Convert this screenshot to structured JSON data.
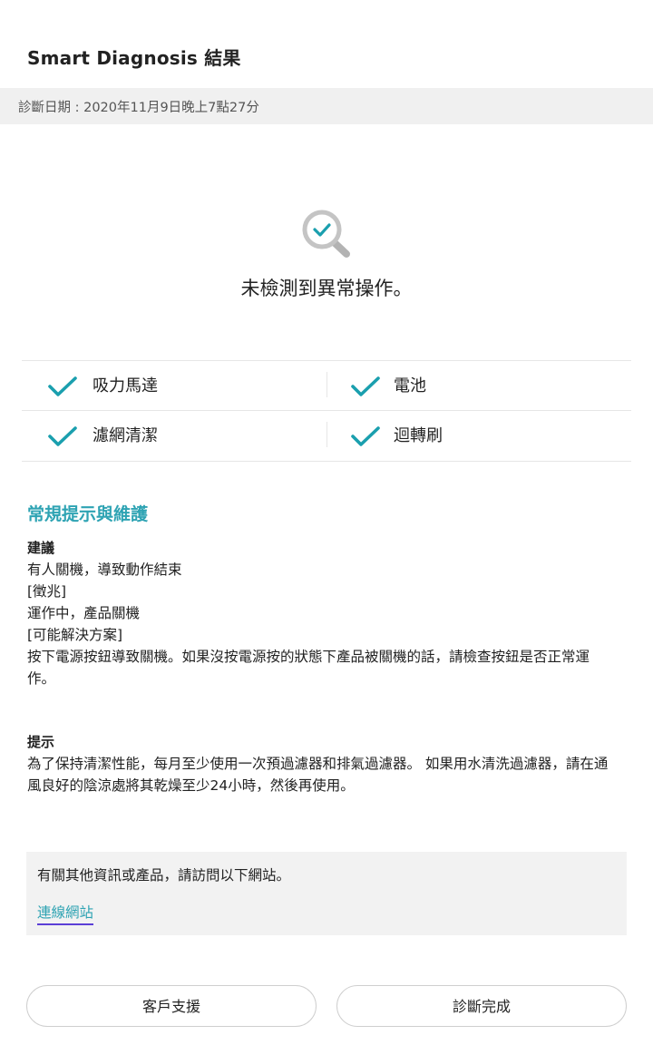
{
  "header": {
    "title": "Smart Diagnosis 結果"
  },
  "diagnosis": {
    "date_text": "診斷日期 : 2020年11月9日晚上7點27分",
    "result_text": "未檢測到異常操作。"
  },
  "checks": [
    {
      "label": "吸力馬達",
      "status": "ok"
    },
    {
      "label": "電池",
      "status": "ok"
    },
    {
      "label": "濾網清潔",
      "status": "ok"
    },
    {
      "label": "迴轉刷",
      "status": "ok"
    }
  ],
  "maintenance": {
    "title": "常規提示與維護",
    "advice": {
      "heading": "建議",
      "lines": [
        "有人關機，導致動作結束",
        "[徵兆]",
        "運作中，產品關機",
        "[可能解決方案]",
        "按下電源按鈕導致關機。如果沒按電源按的狀態下產品被關機的話，請檢查按鈕是否正常運",
        "作。"
      ]
    },
    "tip": {
      "heading": "提示",
      "lines": [
        "為了保持清潔性能，每月至少使用一次預過濾器和排氣過濾器。 如果用水清洗過濾器，請在通",
        "風良好的陰涼處將其乾燥至少24小時，然後再使用。"
      ]
    }
  },
  "info": {
    "text": "有關其他資訊或產品，請訪問以下網站。",
    "link_label": "連線網站"
  },
  "buttons": {
    "support_label": "客戶支援",
    "done_label": "診斷完成"
  },
  "colors": {
    "accent": "#2ea3b3",
    "check": "#1a9fae",
    "link_underline": "#5b3fd6",
    "date_bar": "#f0f0f0"
  },
  "icons": {
    "result": "magnifier-check-icon",
    "check": "checkmark-icon"
  }
}
